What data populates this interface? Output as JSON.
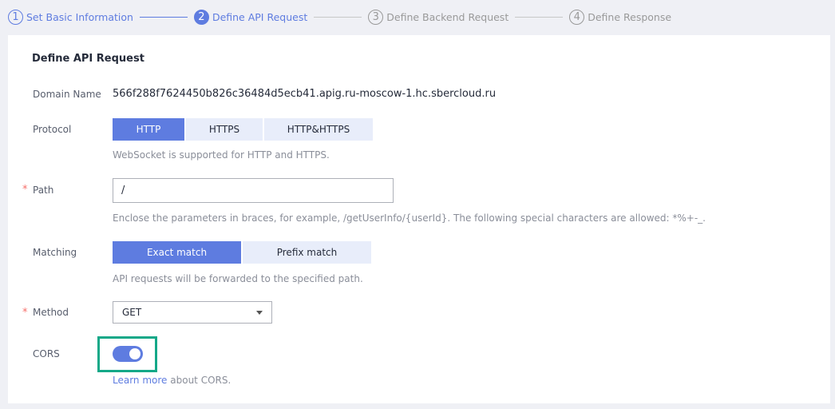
{
  "steps": [
    {
      "num": "1",
      "label": "Set Basic Information",
      "state": "done"
    },
    {
      "num": "2",
      "label": "Define API Request",
      "state": "active"
    },
    {
      "num": "3",
      "label": "Define Backend Request",
      "state": "todo"
    },
    {
      "num": "4",
      "label": "Define Response",
      "state": "todo"
    }
  ],
  "form": {
    "title": "Define API Request",
    "domain_label": "Domain Name",
    "domain_value": "566f288f7624450b826c36484d5ecb41.apig.ru-moscow-1.hc.sbercloud.ru",
    "protocol_label": "Protocol",
    "protocol_options": [
      "HTTP",
      "HTTPS",
      "HTTP&HTTPS"
    ],
    "protocol_selected": "HTTP",
    "protocol_hint": "WebSocket is supported for HTTP and HTTPS.",
    "required_mark": "*",
    "path_label": "Path",
    "path_value": "/",
    "path_hint": "Enclose the parameters in braces, for example, /getUserInfo/{userId}. The following special characters are allowed: *%+-_.",
    "matching_label": "Matching",
    "matching_options": [
      "Exact match",
      "Prefix match"
    ],
    "matching_selected": "Exact match",
    "matching_hint": "API requests will be forwarded to the specified path.",
    "method_label": "Method",
    "method_value": "GET",
    "cors_label": "CORS",
    "cors_enabled": true,
    "cors_link": "Learn more",
    "cors_hint_rest": " about CORS."
  },
  "colors": {
    "accent": "#5e7ce0",
    "highlight": "#14a888",
    "required": "#f66f6a"
  }
}
